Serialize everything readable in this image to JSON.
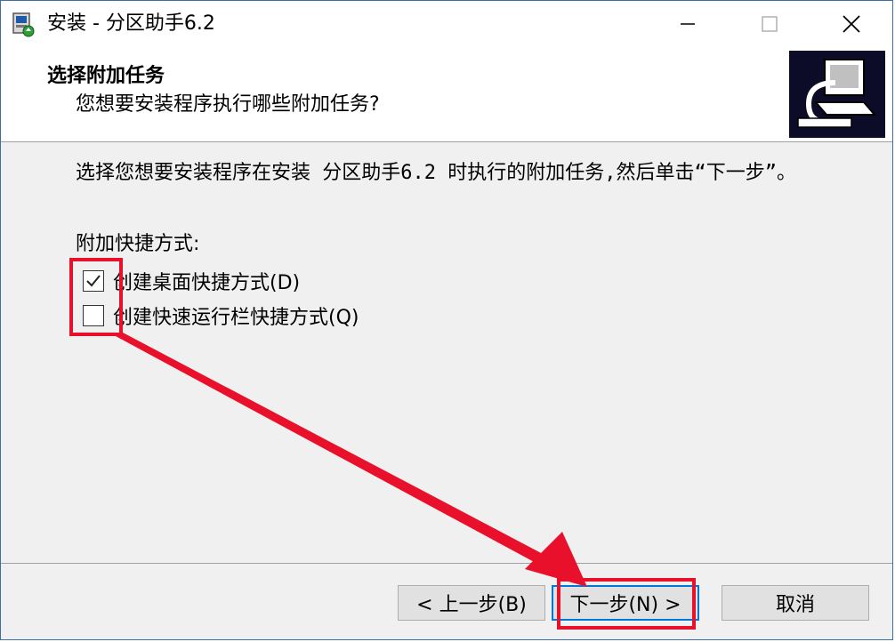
{
  "window": {
    "title": "安装 - 分区助手6.2",
    "controls": {
      "minimize": "—",
      "maximize": "☐",
      "close": "✕"
    }
  },
  "header": {
    "title": "选择附加任务",
    "subtitle": "您想要安装程序执行哪些附加任务?"
  },
  "content": {
    "description": "选择您想要安装程序在安装 分区助手6.2 时执行的附加任务,然后单击“下一步”。",
    "group_label": "附加快捷方式:",
    "options": [
      {
        "label": "创建桌面快捷方式(D)",
        "checked": true
      },
      {
        "label": "创建快速运行栏快捷方式(Q)",
        "checked": false
      }
    ]
  },
  "footer": {
    "back_label": "< 上一步(B)",
    "next_label": "下一步(N) >",
    "cancel_label": "取消"
  },
  "colors": {
    "highlight": "#e8102a",
    "focus": "#0078d7",
    "header_image_bg": "#0c0c28"
  },
  "icons": [
    "installer-icon",
    "computer-install-icon",
    "check-icon",
    "annotation-arrow"
  ]
}
